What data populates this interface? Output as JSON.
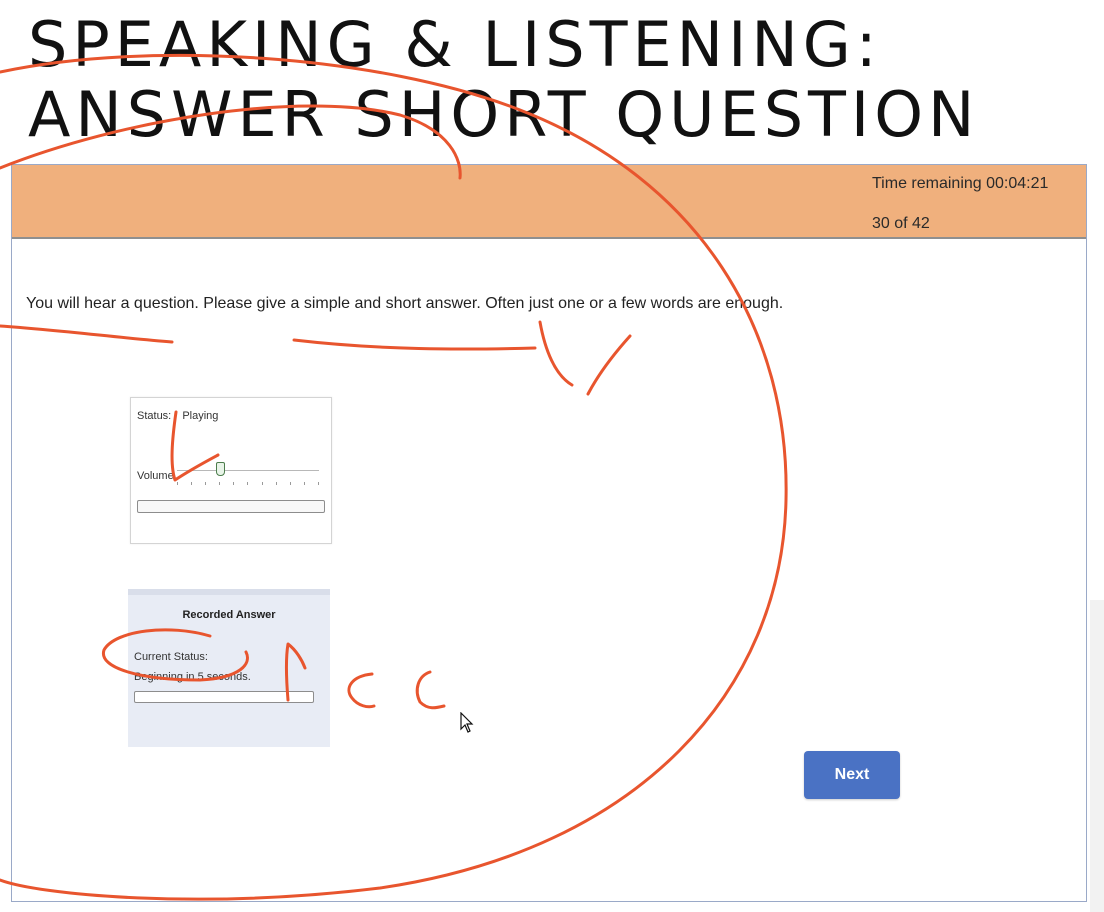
{
  "heading": {
    "line1": "SPEAKING & LISTENING:",
    "line2": "ANSWER SHORT QUESTION"
  },
  "top_bar": {
    "time_remaining": "Time remaining 00:04:21",
    "counter": "30 of 42",
    "color": "#f0b07d"
  },
  "instructions": "You will hear a question. Please give a simple and short answer. Often just one or a few words are enough.",
  "audio_player": {
    "status_label": "Status:",
    "status_value": "Playing",
    "volume_label": "Volume",
    "volume_level": 0.3,
    "playback_progress": 0.0
  },
  "recorder": {
    "title": "Recorded Answer",
    "status_label": "Current Status:",
    "status_value": "Beginning in 5 seconds.",
    "progress": 0.0
  },
  "next_button": {
    "label": "Next",
    "color": "#4a72c4"
  },
  "annotation_color": "#e8552e",
  "icons": [
    "cursor-icon"
  ]
}
